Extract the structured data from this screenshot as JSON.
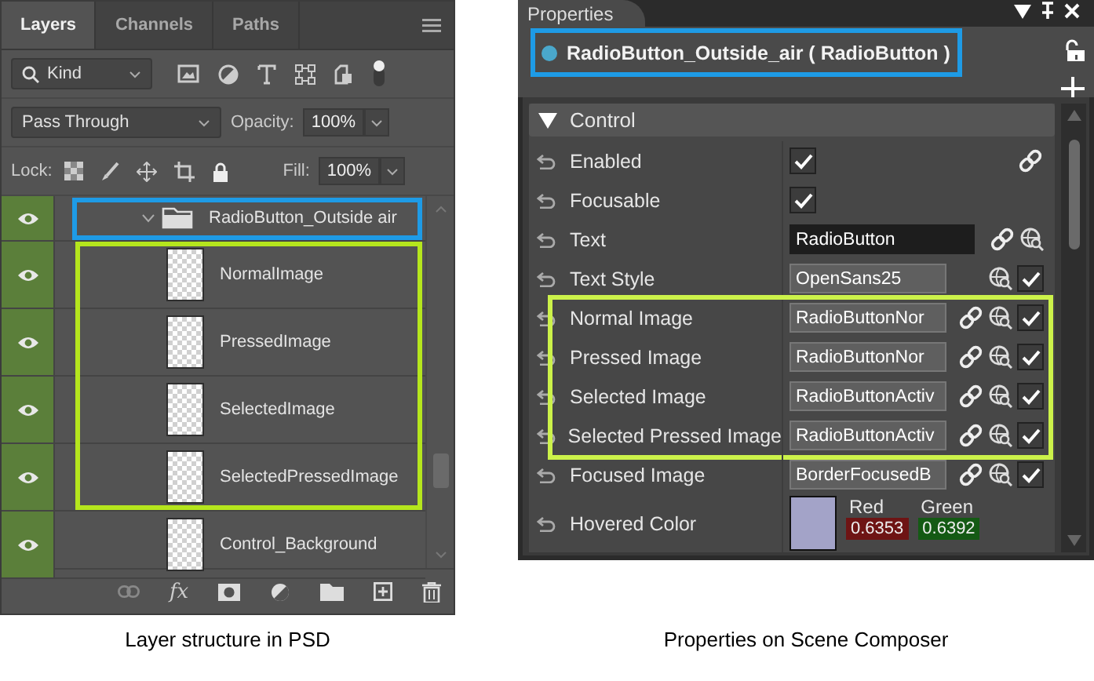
{
  "layers_panel": {
    "tabs": [
      {
        "label": "Layers",
        "selected": true
      },
      {
        "label": "Channels",
        "selected": false
      },
      {
        "label": "Paths",
        "selected": false
      }
    ],
    "filter": {
      "value": "Kind"
    },
    "blend_mode": {
      "value": "Pass Through"
    },
    "opacity": {
      "label": "Opacity:",
      "value": "100%"
    },
    "lock": {
      "label": "Lock:"
    },
    "fill": {
      "label": "Fill:",
      "value": "100%"
    },
    "layer_groups": [
      {
        "color": "#1e9be6",
        "layers": [
          {
            "name": "RadioButton_Outside air",
            "kind": "folder",
            "expanded": true,
            "visible": true
          }
        ]
      },
      {
        "color": "#b5e61d",
        "layers": [
          {
            "name": "NormalImage",
            "kind": "layer",
            "visible": true
          },
          {
            "name": "PressedImage",
            "kind": "layer",
            "visible": true
          },
          {
            "name": "SelectedImage",
            "kind": "layer",
            "visible": true
          },
          {
            "name": "SelectedPressedImage",
            "kind": "layer",
            "visible": true
          }
        ]
      },
      {
        "layers": [
          {
            "name": "Control_Background",
            "kind": "layer",
            "visible": true
          }
        ]
      }
    ],
    "effects_label": "fx",
    "caption": "Layer structure in PSD"
  },
  "properties_panel": {
    "title": "Properties",
    "object": {
      "name": "RadioButton_Outside_air ( RadioButton )",
      "color": "#1e9be6"
    },
    "section": {
      "label": "Control",
      "expanded": true
    },
    "row_groups": [
      {
        "rows": [
          {
            "label": "Enabled",
            "kind": "checkbox",
            "checked": true,
            "link": true
          },
          {
            "label": "Focusable",
            "kind": "checkbox",
            "checked": true
          },
          {
            "label": "Text",
            "kind": "text",
            "value": "RadioButton",
            "link": true,
            "browse": true
          },
          {
            "label": "Text Style",
            "kind": "resource",
            "value": "OpenSans25",
            "browse": true,
            "override": true
          }
        ]
      },
      {
        "color": "#ccf24a",
        "rows": [
          {
            "label": "Normal Image",
            "kind": "resource",
            "value": "RadioButtonNor",
            "link": true,
            "browse": true,
            "override": true
          },
          {
            "label": "Pressed Image",
            "kind": "resource",
            "value": "RadioButtonNor",
            "link": true,
            "browse": true,
            "override": true
          },
          {
            "label": "Selected Image",
            "kind": "resource",
            "value": "RadioButtonActiv",
            "link": true,
            "browse": true,
            "override": true
          },
          {
            "label": "Selected Pressed Image",
            "kind": "resource",
            "value": "RadioButtonActiv",
            "link": true,
            "browse": true,
            "override": true
          }
        ]
      },
      {
        "rows": [
          {
            "label": "Focused Image",
            "kind": "resource",
            "value": "BorderFocusedB",
            "link": true,
            "browse": true,
            "override": true
          },
          {
            "label": "Hovered Color",
            "kind": "color",
            "color": "#a3a3c8",
            "channels": [
              {
                "name": "Red",
                "value": "0.6353",
                "color": "#6e1414"
              },
              {
                "name": "Green",
                "value": "0.6392",
                "color": "#145a14"
              }
            ]
          }
        ]
      }
    ],
    "caption": "Properties on Scene Composer"
  }
}
